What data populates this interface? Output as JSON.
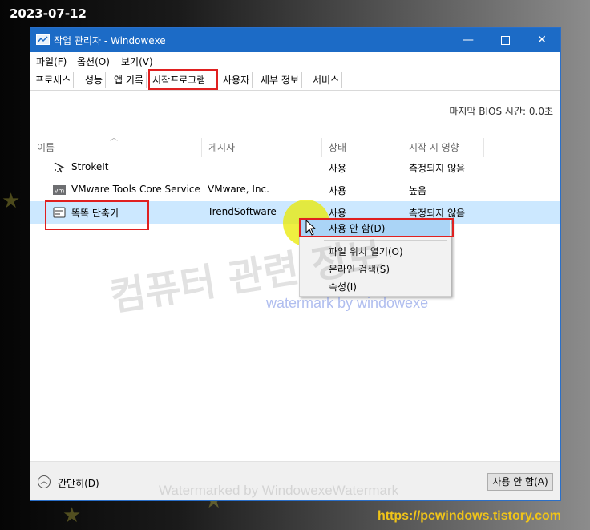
{
  "date_stamp": "2023-07-12",
  "site_url": "https://pcwindows.tistory.com",
  "window": {
    "title": "작업 관리자  - Windowexe"
  },
  "titlebar_controls": {
    "minimize": "—",
    "close": "✕"
  },
  "menu": [
    "파일(F)",
    "옵션(O)",
    "보기(V)"
  ],
  "tabs": [
    "프로세스",
    "성능",
    "앱 기록",
    "시작프로그램",
    "사용자",
    "세부 정보",
    "서비스"
  ],
  "active_tab": "시작프로그램",
  "bios_time": "마지막 BIOS 시간:   0.0초",
  "columns": {
    "name": "이름",
    "publisher": "게시자",
    "status": "상태",
    "impact": "시작 시 영향"
  },
  "rows": [
    {
      "name": "StrokeIt",
      "publisher": "",
      "status": "사용",
      "impact": "측정되지 않음",
      "icon": "strokeit-icon"
    },
    {
      "name": "VMware Tools Core Service",
      "publisher": "VMware, Inc.",
      "status": "사용",
      "impact": "높음",
      "icon": "vmware-icon"
    },
    {
      "name": "똑똑 단축키",
      "publisher": "TrendSoftware",
      "status": "사용",
      "impact": "측정되지 않음",
      "icon": "shortcut-app-icon"
    }
  ],
  "context_menu": [
    "사용 안 함(D)",
    "파일 위치 열기(O)",
    "온라인 검색(S)",
    "속성(I)"
  ],
  "footer": {
    "collapse": "간단히(D)",
    "disable_button": "사용 안 함(A)"
  },
  "watermarks": {
    "korean": "컴퓨터 관련 정보",
    "blue": "watermark by windowexe",
    "bottom": "Watermarked by WindowexeWatermark"
  },
  "colors": {
    "titlebar": "#1c6bc6",
    "selection": "#cce8ff",
    "highlight_box": "#e02020",
    "url": "#f0c419"
  }
}
